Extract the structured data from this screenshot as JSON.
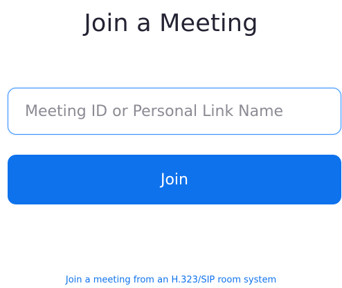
{
  "title": "Join a Meeting",
  "meeting_input": {
    "placeholder": "Meeting ID or Personal Link Name",
    "value": ""
  },
  "join_button": {
    "label": "Join"
  },
  "room_system_link": {
    "label": "Join a meeting from an H.323/SIP room system"
  },
  "colors": {
    "accent": "#0e72ed",
    "input_border": "#2d8cff",
    "title_text": "#232333",
    "placeholder_text": "#8b8b94"
  }
}
